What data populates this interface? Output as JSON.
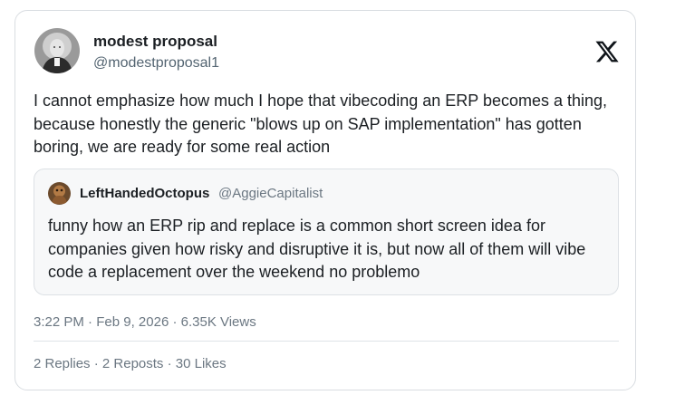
{
  "author": {
    "name": "modest proposal",
    "handle": "@modestproposal1",
    "avatar_icon": "portrait-avatar"
  },
  "logo_icon": "x-logo-icon",
  "tweet": {
    "text": "I cannot emphasize how much I hope that vibecoding an ERP becomes a thing, because honestly the generic \"blows up on SAP implementation\" has gotten boring, we are ready for some real action"
  },
  "quoted_tweet": {
    "name": "LeftHandedOctopus",
    "handle": "@AggieCapitalist",
    "avatar_icon": "octopus-avatar",
    "text": "funny how an ERP rip and replace is a common short screen idea for companies given how risky and disruptive it is, but now all of them will vibe code a replacement over the weekend no problemo"
  },
  "meta": {
    "time": "3:22 PM",
    "date": "Feb 9, 2026",
    "views": "6.35K Views",
    "separator": " · "
  },
  "stats": {
    "replies": "2 Replies",
    "reposts": "2 Reposts",
    "likes": "30 Likes",
    "separator": " · "
  }
}
